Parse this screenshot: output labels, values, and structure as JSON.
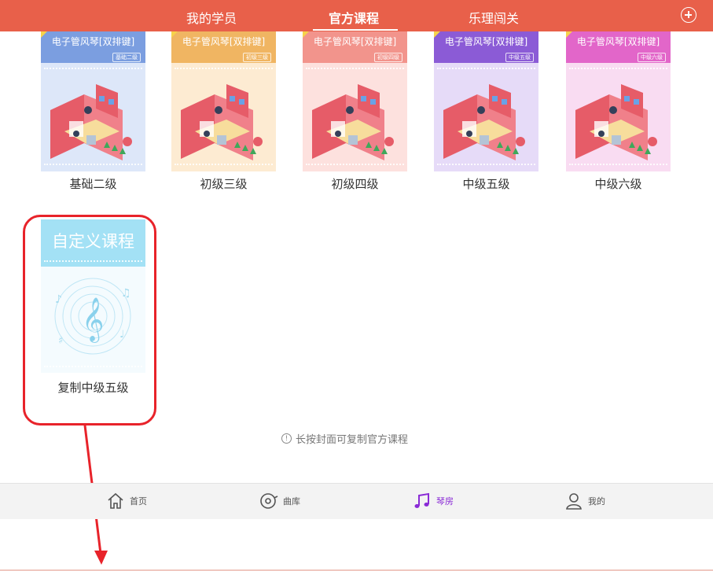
{
  "header": {
    "tabs": [
      {
        "label": "我的学员"
      },
      {
        "label": "官方课程"
      },
      {
        "label": "乐理闯关"
      }
    ],
    "active_tab": "官方课程",
    "add_icon": "plus-circle-icon",
    "background_color": "#e8604a"
  },
  "courses": [
    {
      "cover_title": "电子管风琴[双排键]",
      "badge": "基础二级",
      "label": "基础二级",
      "color": "#7b9ee0"
    },
    {
      "cover_title": "电子管风琴[双排键]",
      "badge": "初级三级",
      "label": "初级三级",
      "color": "#f0b562"
    },
    {
      "cover_title": "电子管风琴[双排键]",
      "badge": "初级四级",
      "label": "初级四级",
      "color": "#f2948c"
    },
    {
      "cover_title": "电子管风琴[双排键]",
      "badge": "中级五级",
      "label": "中级五级",
      "color": "#8b5bd6"
    },
    {
      "cover_title": "电子管风琴[双排键]",
      "badge": "中级六级",
      "label": "中级六级",
      "color": "#e266c9"
    }
  ],
  "custom_course": {
    "cover_title": "自定义课程",
    "label": "复制中级五级",
    "color": "#a3e1f5"
  },
  "hint": "长按封面可复制官方课程",
  "bottom_nav": [
    {
      "label": "首页",
      "icon": "home-icon"
    },
    {
      "label": "曲库",
      "icon": "music-library-icon"
    },
    {
      "label": "琴房",
      "icon": "music-note-icon"
    },
    {
      "label": "我的",
      "icon": "user-icon"
    }
  ],
  "active_nav": "琴房",
  "active_nav_color": "#8a2bd6",
  "highlight_color": "#e8232a"
}
